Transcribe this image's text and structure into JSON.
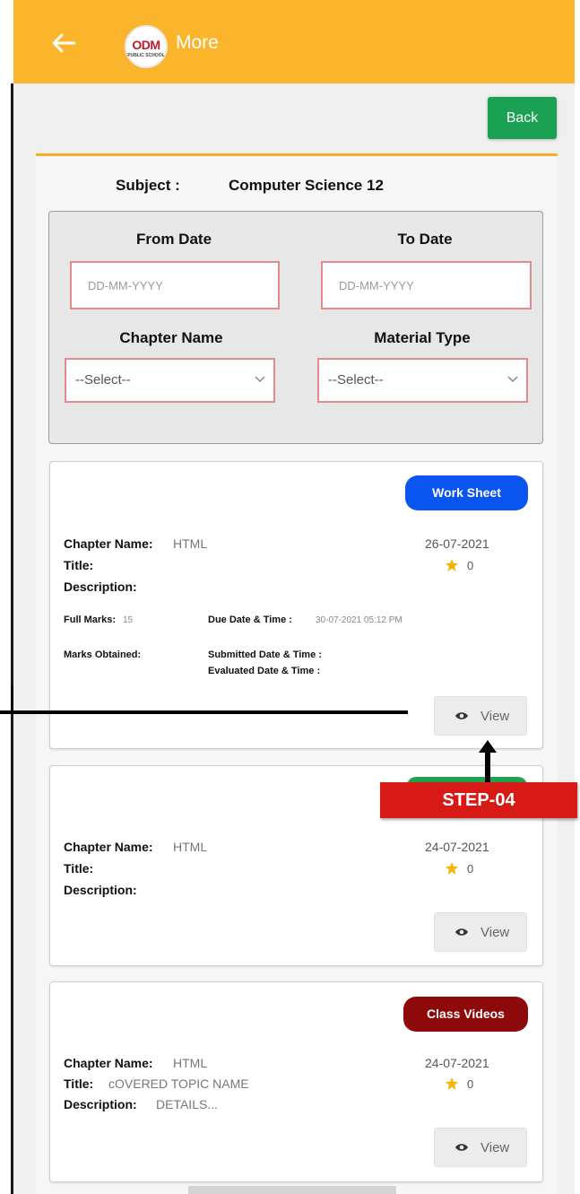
{
  "app_bar": {
    "title": "More",
    "logo_text": "ODM",
    "logo_sub": "PUBLIC SCHOOL"
  },
  "back_button": "Back",
  "subject": {
    "label": "Subject :",
    "value": "Computer Science 12"
  },
  "filters": {
    "from_date_label": "From Date",
    "to_date_label": "To Date",
    "from_date_placeholder": "DD-MM-YYYY",
    "to_date_placeholder": "DD-MM-YYYY",
    "chapter_label": "Chapter Name",
    "material_label": "Material Type",
    "chapter_selected": "--Select--",
    "material_selected": "--Select--"
  },
  "cards": [
    {
      "badge": "Work Sheet",
      "badge_color": "#0a55f0",
      "chapter_label": "Chapter Name:",
      "chapter_value": "HTML",
      "title_label": "Title:",
      "title_value": "",
      "desc_label": "Description:",
      "desc_value": "",
      "date": "26-07-2021",
      "rating": "0",
      "full_marks_label": "Full Marks:",
      "full_marks_value": "15",
      "due_label": "Due Date & Time :",
      "due_value": "30-07-2021 05:12 PM",
      "marks_obtained_label": "Marks Obtained:",
      "submitted_label": "Submitted Date & Time :",
      "evaluated_label": "Evaluated Date & Time :",
      "view_label": "View"
    },
    {
      "badge": "",
      "badge_color": "#21a04d",
      "chapter_label": "Chapter Name:",
      "chapter_value": "HTML",
      "title_label": "Title:",
      "title_value": "",
      "desc_label": "Description:",
      "desc_value": "",
      "date": "24-07-2021",
      "rating": "0",
      "view_label": "View"
    },
    {
      "badge": "Class Videos",
      "badge_color": "#8e0a0a",
      "chapter_label": "Chapter Name:",
      "chapter_value": "HTML",
      "title_label": "Title:",
      "title_value": "cOVERED TOPIC NAME",
      "desc_label": "Description:",
      "desc_value": "DETAILS...",
      "date": "24-07-2021",
      "rating": "0",
      "view_label": "View"
    }
  ],
  "annotation": {
    "step_label": "STEP-04",
    "color": "#d81a17"
  }
}
